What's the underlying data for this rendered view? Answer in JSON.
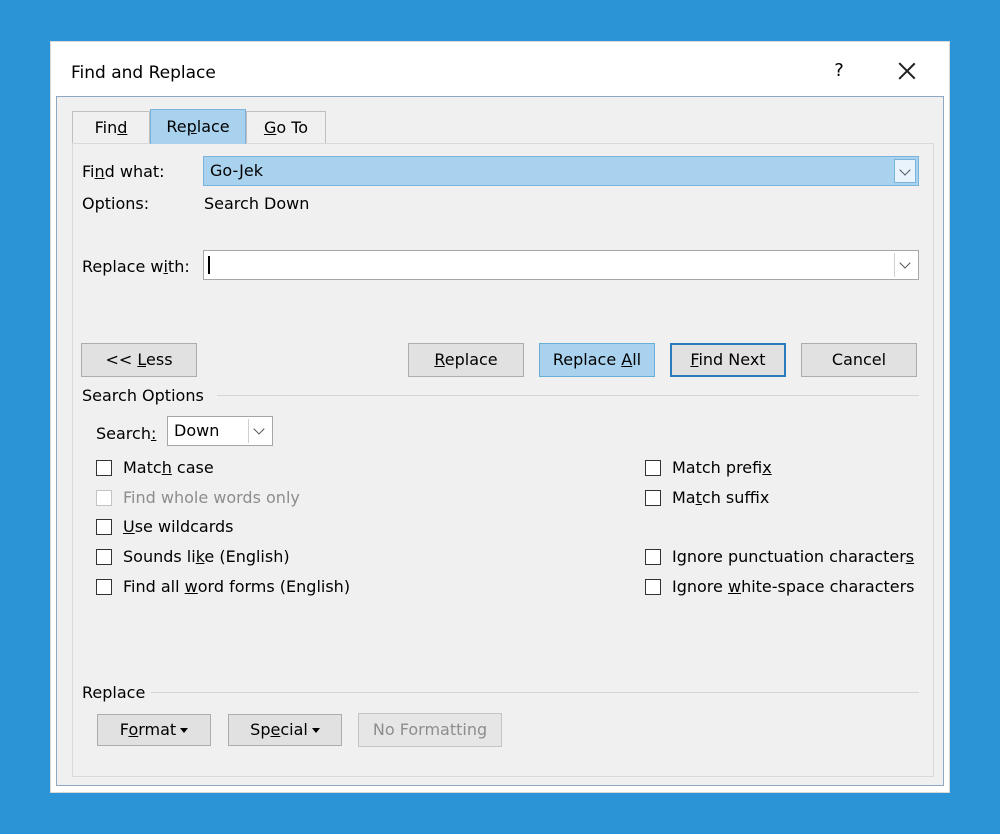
{
  "dialog": {
    "title": "Find and Replace",
    "help_label": "?"
  },
  "tabs": [
    {
      "label_pre": "Fin",
      "label_u": "d",
      "label_post": ""
    },
    {
      "label_pre": "Re",
      "label_u": "p",
      "label_post": "lace"
    },
    {
      "label_pre": "",
      "label_u": "G",
      "label_post": "o To"
    }
  ],
  "find": {
    "label_pre": "Fi",
    "label_u": "n",
    "label_post": "d what:",
    "value": "Go-Jek",
    "options_label": "Options:",
    "options_value": "Search Down"
  },
  "replace_with": {
    "label_pre": "Replace w",
    "label_u": "i",
    "label_post": "th:",
    "value": ""
  },
  "buttons": {
    "less": {
      "pre": "<< ",
      "u": "L",
      "post": "ess"
    },
    "replace": {
      "pre": "",
      "u": "R",
      "post": "eplace"
    },
    "replace_all": {
      "pre": "Replace ",
      "u": "A",
      "post": "ll"
    },
    "find_next": {
      "pre": "",
      "u": "F",
      "post": "ind Next"
    },
    "cancel": "Cancel"
  },
  "search_options": {
    "heading": "Search Options",
    "search_label_pre": "Search",
    "search_label_u": ":",
    "search_value": "Down",
    "checkboxes_left": [
      {
        "pre": "Matc",
        "u": "h",
        "post": " case",
        "checked": false,
        "enabled": true
      },
      {
        "pre": "Find whole words only",
        "u": "",
        "post": "",
        "checked": false,
        "enabled": false
      },
      {
        "pre": "",
        "u": "U",
        "post": "se wildcards",
        "checked": false,
        "enabled": true
      },
      {
        "pre": "Sounds li",
        "u": "k",
        "post": "e (English)",
        "checked": false,
        "enabled": true
      },
      {
        "pre": "Find all ",
        "u": "w",
        "post": "ord forms (English)",
        "checked": false,
        "enabled": true
      }
    ],
    "checkboxes_right": [
      {
        "pre": "Match prefi",
        "u": "x",
        "post": "",
        "checked": false,
        "enabled": true
      },
      {
        "pre": "Ma",
        "u": "t",
        "post": "ch suffix",
        "checked": false,
        "enabled": true
      },
      {
        "pre": "Ignore punctuation character",
        "u": "s",
        "post": "",
        "checked": false,
        "enabled": true
      },
      {
        "pre": "Ignore ",
        "u": "w",
        "post": "hite-space characters",
        "checked": false,
        "enabled": true
      }
    ]
  },
  "replace_section": {
    "heading": "Replace",
    "format": {
      "pre": "F",
      "u": "o",
      "post": "rmat"
    },
    "special": {
      "pre": "Sp",
      "u": "e",
      "post": "cial"
    },
    "no_formatting": "No Formatting"
  }
}
